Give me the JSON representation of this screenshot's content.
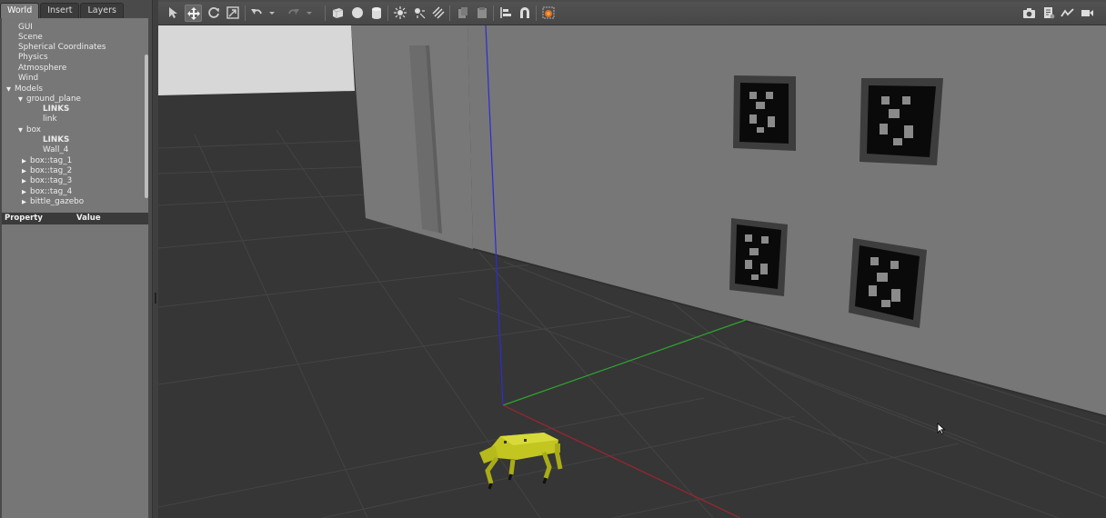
{
  "tabs": [
    {
      "label": "World",
      "active": true
    },
    {
      "label": "Insert",
      "active": false
    },
    {
      "label": "Layers",
      "active": false
    }
  ],
  "tree": {
    "gui": "GUI",
    "scene": "Scene",
    "spherical": "Spherical Coordinates",
    "physics": "Physics",
    "atmosphere": "Atmosphere",
    "wind": "Wind",
    "models": "Models",
    "ground_plane": "ground_plane",
    "links_1": "LINKS",
    "link": "link",
    "box": "box",
    "links_2": "LINKS",
    "wall": "Wall_4",
    "tag1": "box::tag_1",
    "tag2": "box::tag_2",
    "tag3": "box::tag_3",
    "tag4": "box::tag_4",
    "bittle": "bittle_gazebo"
  },
  "properties": {
    "col_property": "Property",
    "col_value": "Value"
  },
  "toolbar": {
    "tools": [
      "select-arrow-icon",
      "translate-icon",
      "rotate-icon",
      "scale-icon",
      "undo-icon",
      "undo-dropdown-icon",
      "redo-icon",
      "redo-dropdown-icon",
      "box-shape-icon",
      "sphere-shape-icon",
      "cylinder-shape-icon",
      "sun-light-icon",
      "point-light-icon",
      "directional-light-icon",
      "copy-icon",
      "paste-icon",
      "align-icon",
      "magnet-snap-icon",
      "change-view-icon"
    ],
    "right_tools": [
      "screenshot-icon",
      "log-icon",
      "plot-icon",
      "video-icon"
    ],
    "active_tool": "translate-icon"
  },
  "scene": {
    "sky_color": "#d7d7d7",
    "ground_color": "#363636",
    "wall_color": "#777777",
    "axis_colors": {
      "x": "#a0242f",
      "y": "#2ea62e",
      "z": "#2c2cd4"
    },
    "robot_color": "#c3c620",
    "marker_icons": [
      "apriltag-marker-1",
      "apriltag-marker-2",
      "apriltag-marker-3",
      "apriltag-marker-4"
    ]
  }
}
